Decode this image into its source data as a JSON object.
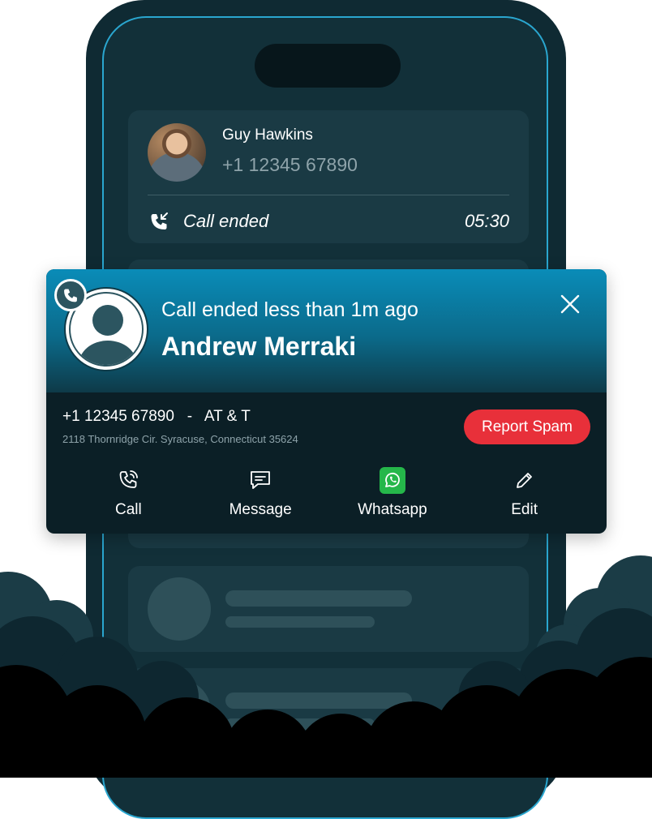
{
  "recent_call": {
    "name": "Guy Hawkins",
    "phone": "+1 12345 67890",
    "status": "Call ended",
    "duration": "05:30"
  },
  "popup": {
    "subtitle": "Call ended less than 1m ago",
    "caller_name": "Andrew Merraki",
    "number_line": "+1 12345 67890   -   AT & T",
    "address": "2118 Thornridge Cir. Syracuse, Connecticut 35624",
    "spam_label": "Report Spam",
    "actions": [
      {
        "label": "Call",
        "icon": "phone-icon"
      },
      {
        "label": "Message",
        "icon": "message-icon"
      },
      {
        "label": "Whatsapp",
        "icon": "whatsapp-icon"
      },
      {
        "label": "Edit",
        "icon": "edit-icon"
      }
    ]
  },
  "colors": {
    "accent": "#0a8cb8",
    "spam": "#e8303a",
    "whatsapp": "#25b74a",
    "phone_body": "#0f2a33"
  }
}
